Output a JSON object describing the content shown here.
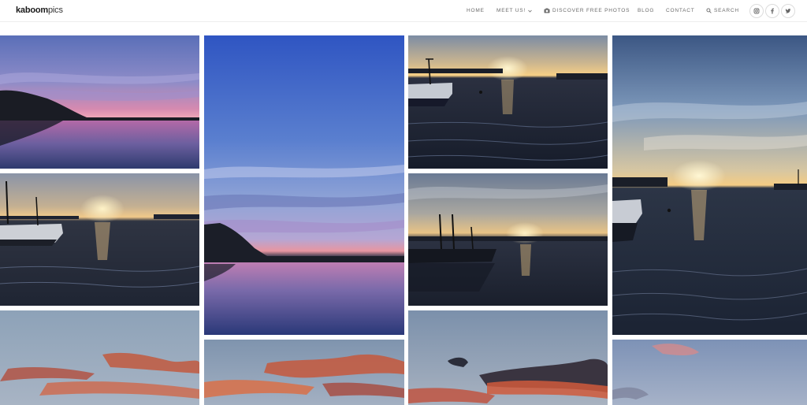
{
  "header": {
    "logo_bold": "kaboom",
    "logo_light": "pics"
  },
  "nav": {
    "home": "HOME",
    "meet_us": "MEET US!",
    "discover": "DISCOVER FREE PHOTOS",
    "blog": "BLOG",
    "contact": "CONTACT",
    "search": "SEARCH"
  },
  "social": [
    "instagram-icon",
    "facebook-icon",
    "twitter-icon"
  ],
  "gallery": {
    "photos": [
      {
        "name": "photo-dusk-headland",
        "scene": "dusk"
      },
      {
        "name": "photo-boat-sunset-1",
        "scene": "boat-sunset"
      },
      {
        "name": "photo-twilight-sky-tall",
        "scene": "twilight"
      },
      {
        "name": "photo-boat-golden-hour",
        "scene": "boat-golden"
      },
      {
        "name": "photo-boats-silhouette",
        "scene": "boats-silhouette"
      },
      {
        "name": "photo-sunset-tall",
        "scene": "sunset-tall"
      },
      {
        "name": "photo-clouds-1",
        "scene": "clouds"
      },
      {
        "name": "photo-clouds-2",
        "scene": "clouds"
      },
      {
        "name": "photo-clouds-3",
        "scene": "clouds-dark"
      },
      {
        "name": "photo-clouds-4",
        "scene": "clouds-light"
      }
    ]
  },
  "colors": {
    "nav_text": "#6b6b6b",
    "twilight_blue": "#4a6fc0",
    "sunset_gold": "#f2c066",
    "water_dark": "#1f2a3c"
  }
}
